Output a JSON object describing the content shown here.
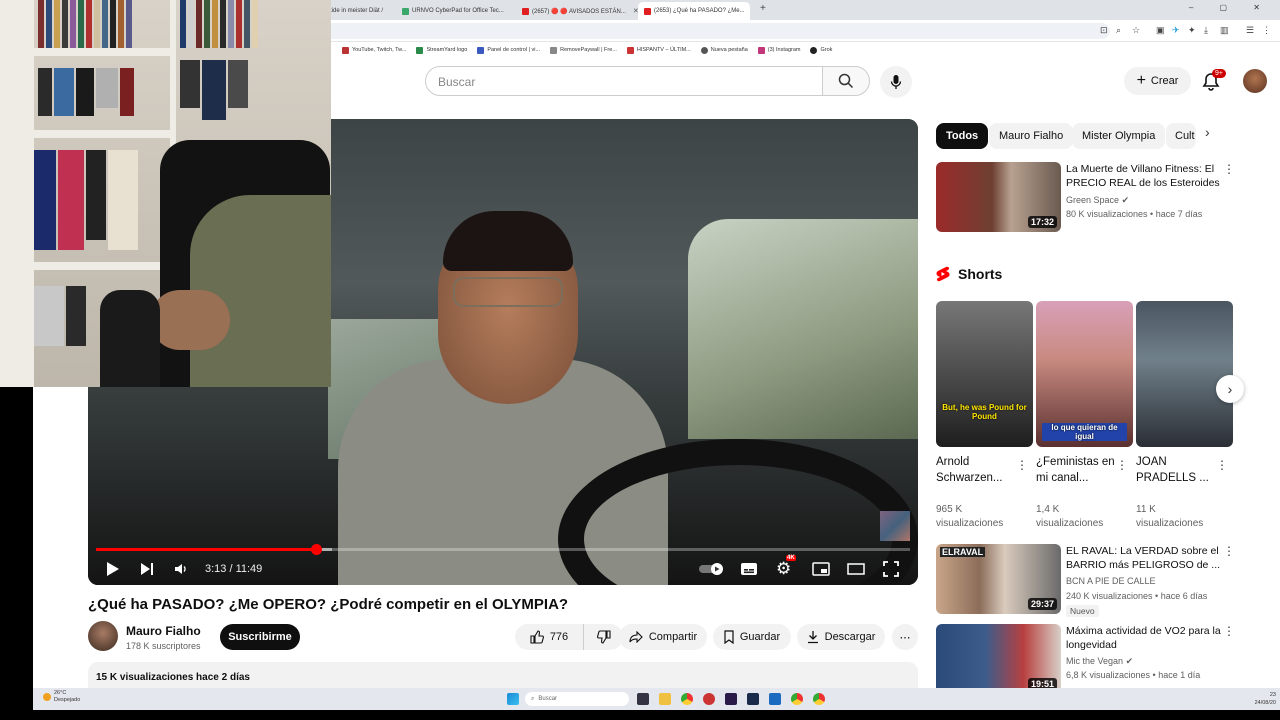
{
  "browser": {
    "tabs": [
      {
        "label": "tide in meister Diät /",
        "color": "#4a7bd0"
      },
      {
        "label": "URNVO CyberPad for Office Tec...",
        "color": "#3aa86b"
      },
      {
        "label": "(2657) 🔴 🔴 AVISADOS ESTÁN...",
        "color": "#e02020"
      },
      {
        "label": "(2653) ¿Qué ha PASADO? ¿Me...",
        "color": "#e02020"
      }
    ],
    "new_tab": "+",
    "window_controls": "– ▢ ✕",
    "bookmarks": [
      {
        "label": "YouTube, Twitch, Tw...",
        "color": "#b33"
      },
      {
        "label": "StreamYard logo",
        "color": "#2a8a4a"
      },
      {
        "label": "Panel de control | vi...",
        "color": "#3a5ac0"
      },
      {
        "label": "RemovePaywall | Fre...",
        "color": "#888"
      },
      {
        "label": "HISPANTV – ÚLTIM...",
        "color": "#c33"
      },
      {
        "label": "Nueva pestaña",
        "color": "#555"
      },
      {
        "label": "(3) Instagram",
        "color": "#c2367a"
      },
      {
        "label": "Grok",
        "color": "#222"
      }
    ]
  },
  "youtube": {
    "search_placeholder": "Buscar",
    "create_label": "Crear",
    "notif_count": "9+"
  },
  "player": {
    "time": "3:13 / 11:49",
    "progress": 0.27,
    "buffered": 0.29,
    "quality_badge": "4K"
  },
  "video": {
    "title": "¿Qué ha PASADO? ¿Me OPERO? ¿Podré competir en el OLYMPIA?",
    "channel": "Mauro Fialho",
    "subscribers": "178 K suscriptores",
    "subscribe_label": "Suscribirme",
    "likes": "776",
    "share_label": "Compartir",
    "save_label": "Guardar",
    "download_label": "Descargar",
    "more": "⋯",
    "views_date": "15 K visualizaciones  hace 2 días"
  },
  "sidebar": {
    "chips": [
      "Todos",
      "Mauro Fialho",
      "Mister Olympia",
      "Cult"
    ],
    "related": [
      {
        "title": "La Muerte de Villano Fitness: El PRECIO REAL de los Esteroides",
        "channel": "Green Space",
        "verified": true,
        "meta": "80 K visualizaciones • hace 7 días",
        "duration": "17:32",
        "badge": ""
      },
      {
        "title": "EL RAVAL: La VERDAD sobre el BARRIO más PELIGROSO de ...",
        "channel": "BCN A PIE DE CALLE",
        "verified": false,
        "meta": "240 K visualizaciones • hace 6 días",
        "duration": "29:37",
        "badge": "Nuevo"
      },
      {
        "title": "Máxima actividad de VO2 para la longevidad",
        "channel": "Mic the Vegan",
        "verified": true,
        "meta": "6,8 K visualizaciones • hace 1 día",
        "duration": "19:51",
        "badge": ""
      }
    ],
    "shorts_heading": "Shorts",
    "shorts": [
      {
        "title": "Arnold Schwarzen...",
        "views": "965 K visualizaciones",
        "caption": "But, he was Pound for Pound"
      },
      {
        "title": "¿Feministas en mi canal...",
        "views": "1,4 K visualizaciones",
        "caption": "lo que quieran de igual"
      },
      {
        "title": "JOAN PRADELLS ...",
        "views": "11 K visualizaciones",
        "caption": ""
      }
    ]
  },
  "taskbar": {
    "weather_temp": "26°C",
    "weather_desc": "Despejado",
    "search": "Buscar",
    "time": "23",
    "date": "24/08/20"
  }
}
